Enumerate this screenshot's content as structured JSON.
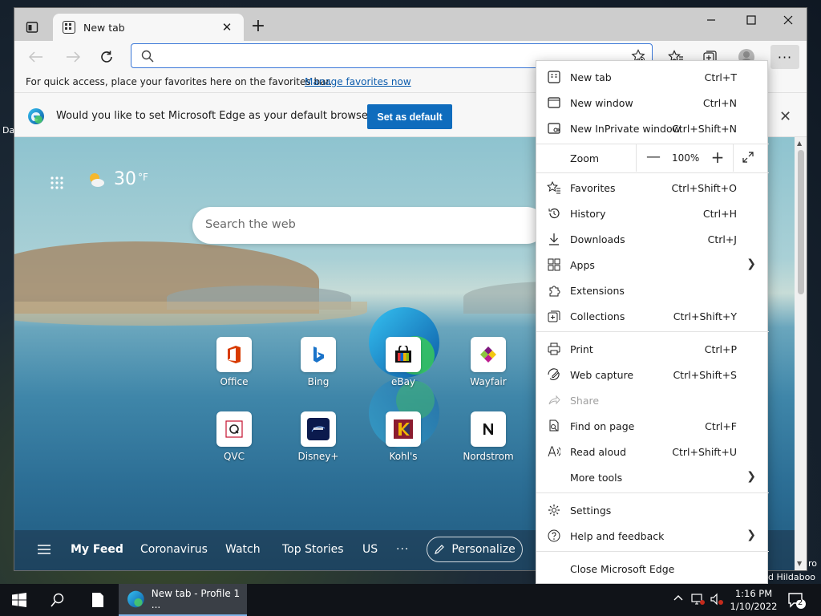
{
  "desktop": {
    "peek_left": "Da",
    "peek_right_top": "ro",
    "peek_right_bottom": "d Hildaboo"
  },
  "tab": {
    "title": "New tab"
  },
  "address": {
    "value": "",
    "placeholder": ""
  },
  "favbar": {
    "text": "For quick access, place your favorites here on the favorites bar.",
    "link": "Manage favorites now"
  },
  "infobar": {
    "text": "Would you like to set Microsoft Edge as your default browser?",
    "button": "Set as default"
  },
  "ntp": {
    "weather_temp": "30",
    "weather_unit": "°F",
    "search_placeholder": "Search the web",
    "tiles": [
      {
        "label": "Office"
      },
      {
        "label": "Bing"
      },
      {
        "label": "eBay"
      },
      {
        "label": "Wayfair"
      },
      {
        "label": "QVC"
      },
      {
        "label": "Disney+"
      },
      {
        "label": "Kohl's"
      },
      {
        "label": "Nordstrom"
      }
    ],
    "feed": {
      "my_feed": "My Feed",
      "items": [
        "Coronavirus",
        "Watch",
        "Top Stories",
        "US"
      ],
      "more": "···",
      "personalize": "Personalize"
    }
  },
  "menu": {
    "items": [
      {
        "label": "New tab",
        "shortcut": "Ctrl+T",
        "icon": "new-tab-icon"
      },
      {
        "label": "New window",
        "shortcut": "Ctrl+N",
        "icon": "new-window-icon"
      },
      {
        "label": "New InPrivate window",
        "shortcut": "Ctrl+Shift+N",
        "icon": "inprivate-icon"
      },
      {
        "label": "Favorites",
        "shortcut": "Ctrl+Shift+O",
        "icon": "favorites-icon"
      },
      {
        "label": "History",
        "shortcut": "Ctrl+H",
        "icon": "history-icon"
      },
      {
        "label": "Downloads",
        "shortcut": "Ctrl+J",
        "icon": "downloads-icon"
      },
      {
        "label": "Apps",
        "shortcut": "",
        "icon": "apps-icon"
      },
      {
        "label": "Extensions",
        "shortcut": "",
        "icon": "extensions-icon"
      },
      {
        "label": "Collections",
        "shortcut": "Ctrl+Shift+Y",
        "icon": "collections-icon"
      },
      {
        "label": "Print",
        "shortcut": "Ctrl+P",
        "icon": "print-icon"
      },
      {
        "label": "Web capture",
        "shortcut": "Ctrl+Shift+S",
        "icon": "web-capture-icon"
      },
      {
        "label": "Share",
        "shortcut": "",
        "icon": "share-icon"
      },
      {
        "label": "Find on page",
        "shortcut": "Ctrl+F",
        "icon": "find-icon"
      },
      {
        "label": "Read aloud",
        "shortcut": "Ctrl+Shift+U",
        "icon": "read-aloud-icon"
      },
      {
        "label": "More tools",
        "shortcut": "",
        "icon": ""
      },
      {
        "label": "Settings",
        "shortcut": "",
        "icon": "settings-icon"
      },
      {
        "label": "Help and feedback",
        "shortcut": "",
        "icon": "help-icon"
      },
      {
        "label": "Close Microsoft Edge",
        "shortcut": "",
        "icon": ""
      }
    ],
    "zoom_label": "Zoom",
    "zoom_value": "100%",
    "zoom_minus": "—",
    "zoom_plus": "+"
  },
  "taskbar": {
    "app_label": "New tab - Profile 1 ...",
    "time": "1:16 PM",
    "date": "1/10/2022",
    "notifications": "2"
  },
  "colors": {
    "accent": "#0f6cbd",
    "menu_bg": "#ffffff",
    "taskbar": "#101318"
  }
}
